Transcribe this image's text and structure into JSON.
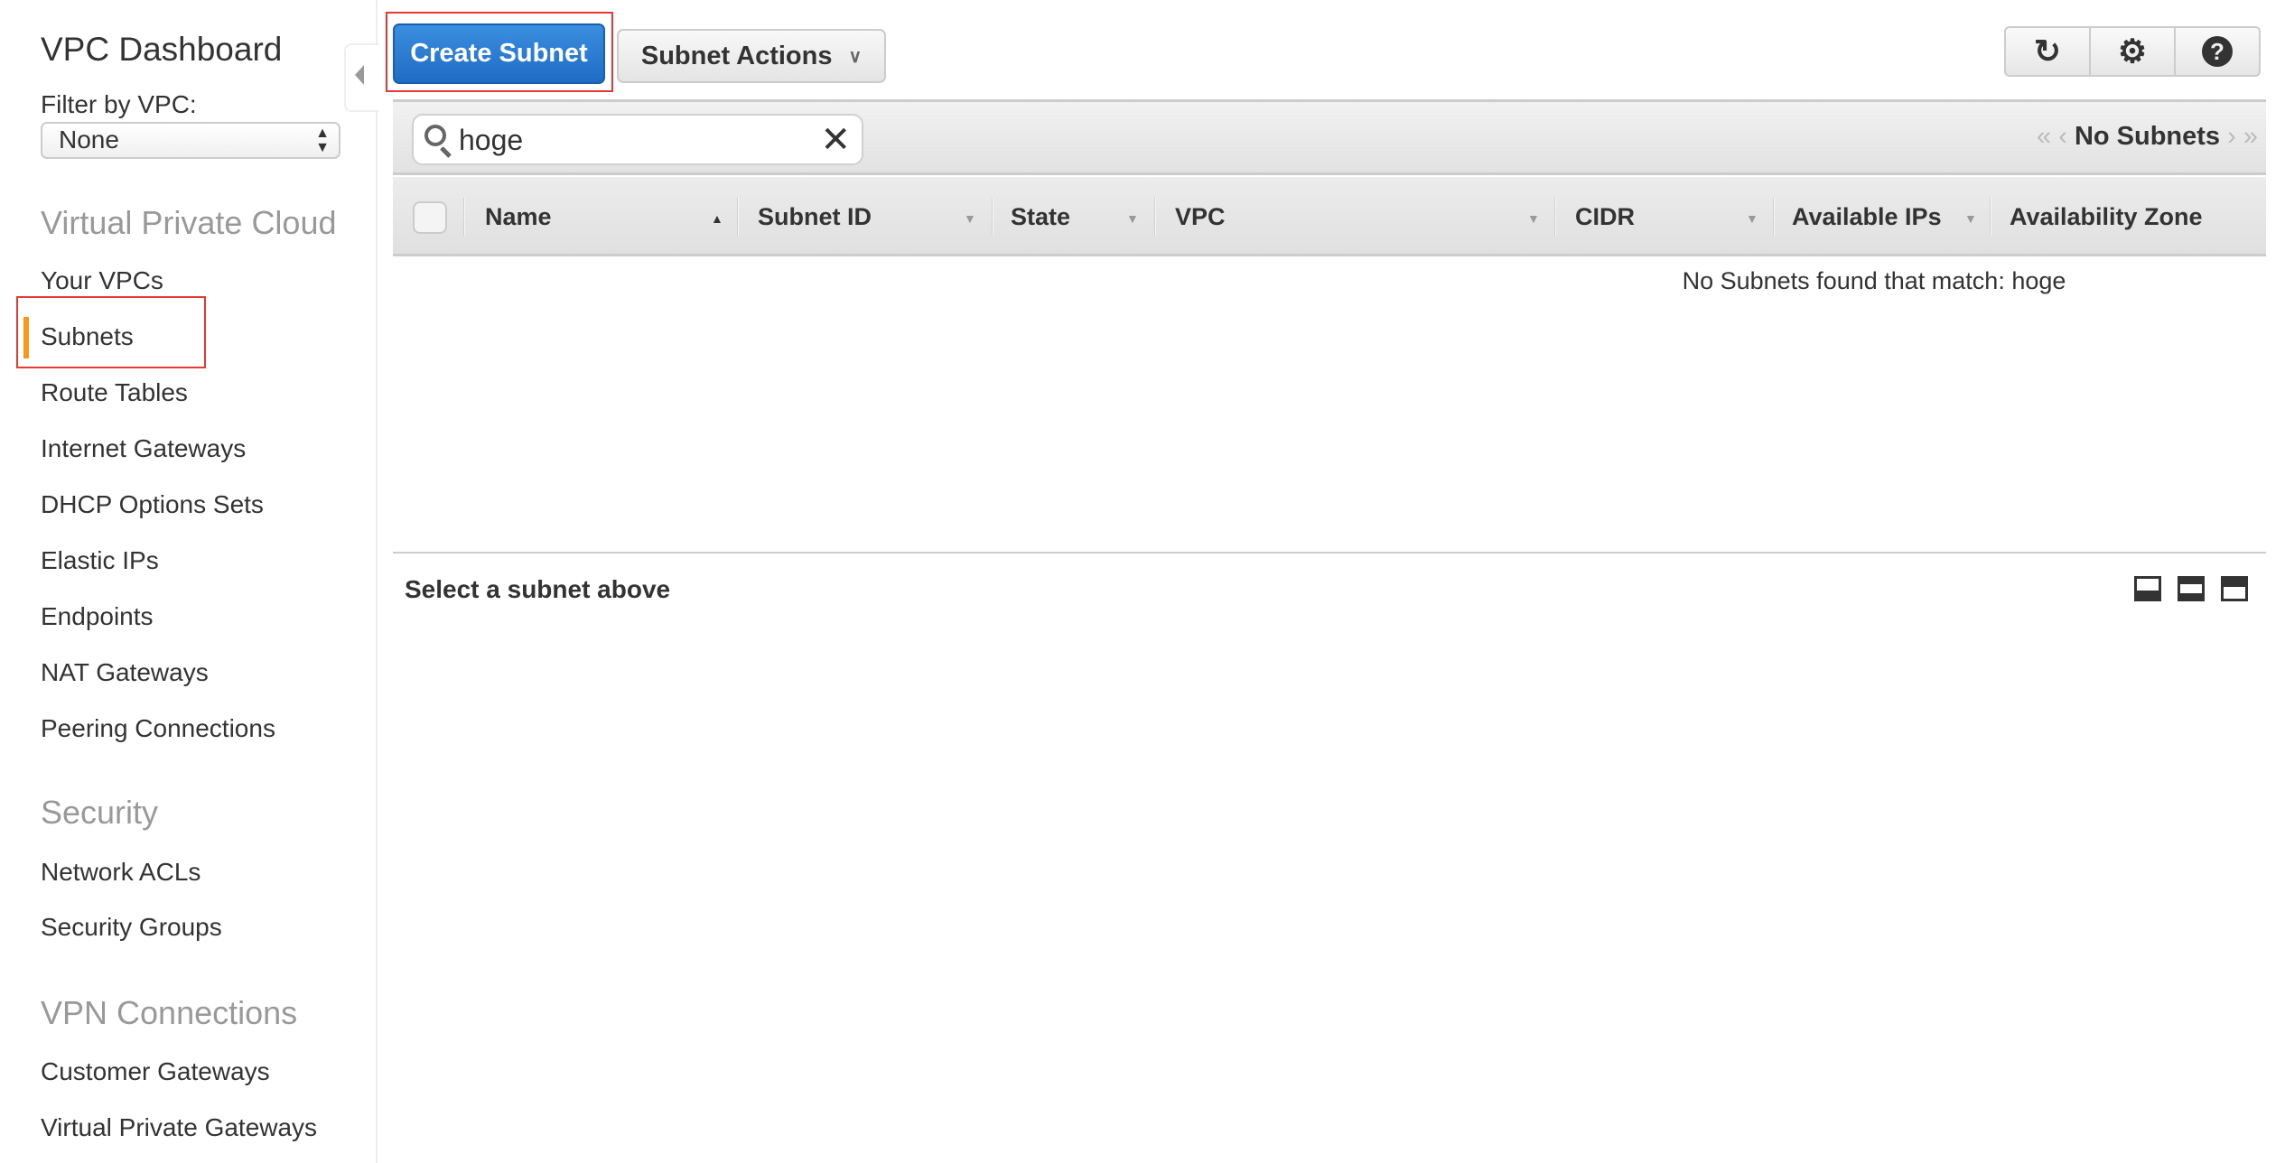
{
  "sidebar": {
    "title": "VPC Dashboard",
    "filter_label": "Filter by VPC:",
    "filter_value": "None",
    "sections": [
      {
        "title": "Virtual Private Cloud",
        "items": [
          "Your VPCs",
          "Subnets",
          "Route Tables",
          "Internet Gateways",
          "DHCP Options Sets",
          "Elastic IPs",
          "Endpoints",
          "NAT Gateways",
          "Peering Connections"
        ]
      },
      {
        "title": "Security",
        "items": [
          "Network ACLs",
          "Security Groups"
        ]
      },
      {
        "title": "VPN Connections",
        "items": [
          "Customer Gateways",
          "Virtual Private Gateways"
        ]
      }
    ],
    "active_item": "Subnets",
    "accent": "#f7981d"
  },
  "toolbar": {
    "create_label": "Create Subnet",
    "actions_label": "Subnet Actions",
    "icons": [
      "refresh-icon",
      "gear-icon",
      "help-icon"
    ]
  },
  "search": {
    "value": "hoge"
  },
  "pager": {
    "label": "No Subnets"
  },
  "table": {
    "columns": [
      "Name",
      "Subnet ID",
      "State",
      "VPC",
      "CIDR",
      "Available IPs",
      "Availability Zone"
    ],
    "empty_message": "No Subnets found that match: hoge"
  },
  "details": {
    "message": "Select a subnet above"
  },
  "colors": {
    "primary": "#1f6cc5",
    "highlight": "#e53935"
  }
}
